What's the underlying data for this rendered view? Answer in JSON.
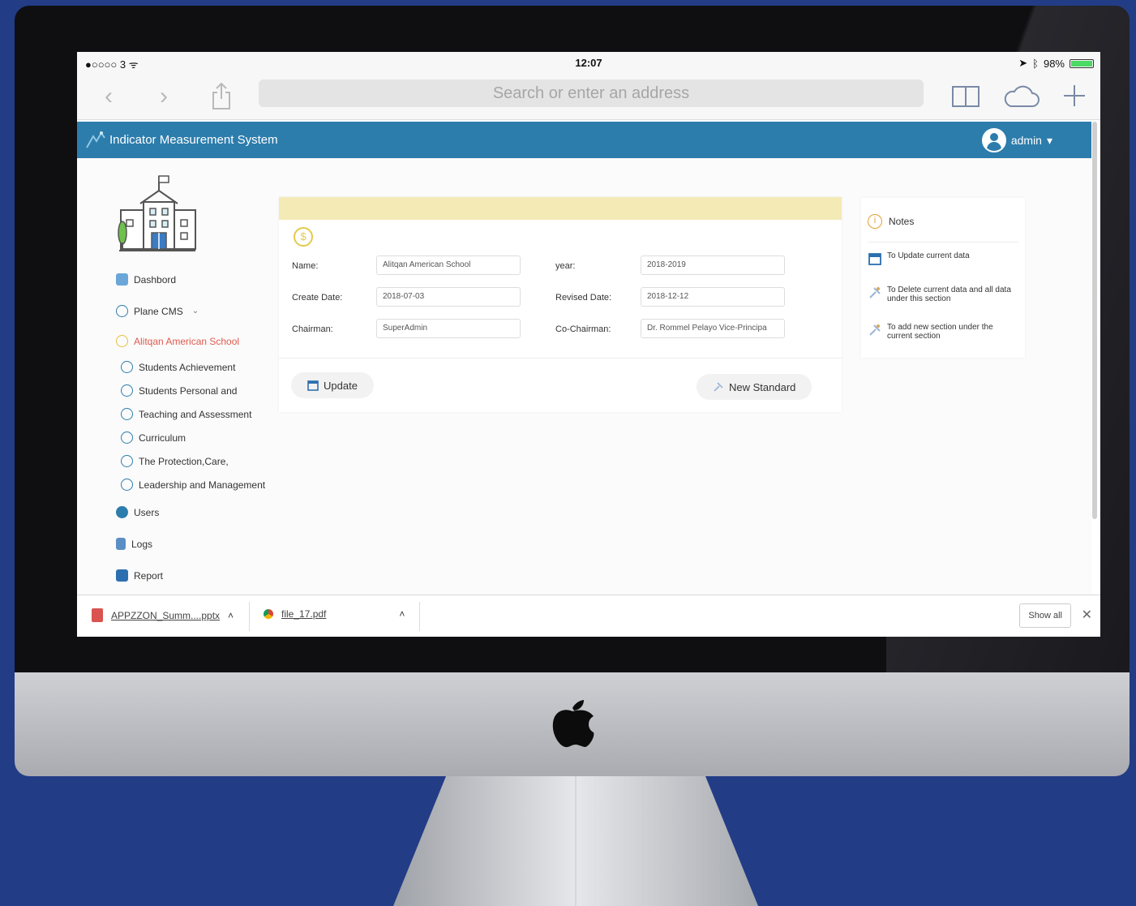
{
  "status_bar": {
    "carrier": "●○○○○ 3 ᯤ",
    "time": "12:07",
    "battery_text": "98%",
    "location_icon": "location-arrow-icon",
    "bluetooth_icon": "bluetooth-icon"
  },
  "browser": {
    "address_placeholder": "Search or enter an address",
    "icons": [
      "back-icon",
      "forward-icon",
      "share-icon",
      "bookmarks-icon",
      "cloud-icon",
      "new-tab-icon"
    ]
  },
  "app": {
    "title": "Indicator Measurement System",
    "user": "admin",
    "header_color": "#2c7dac"
  },
  "sidebar": {
    "items": [
      {
        "label": "Dashbord",
        "icon": "dashboard-icon"
      },
      {
        "label": "Plane CMS",
        "icon": "cms-icon"
      },
      {
        "label": "Alitqan American School",
        "icon": "coin-icon",
        "active": true
      },
      {
        "label": "Students Achievement",
        "icon": "section-icon"
      },
      {
        "label": "Students Personal and",
        "icon": "section-icon"
      },
      {
        "label": "Teaching and Assessment",
        "icon": "section-icon"
      },
      {
        "label": "Curriculum",
        "icon": "section-icon"
      },
      {
        "label": "The Protection,Care,",
        "icon": "section-icon"
      },
      {
        "label": "Leadership and Management",
        "icon": "section-icon"
      },
      {
        "label": "Users",
        "icon": "user-icon"
      },
      {
        "label": "Logs",
        "icon": "logs-icon"
      },
      {
        "label": "Report",
        "icon": "printer-icon"
      }
    ]
  },
  "form": {
    "name_label": "Name:",
    "name_value": "Alitqan American School",
    "year_label": "year:",
    "year_value": "2018-2019",
    "create_date_label": "Create Date:",
    "create_date_value": "2018-07-03",
    "revised_date_label": "Revised Date:",
    "revised_date_value": "2018-12-12",
    "chairman_label": "Chairman:",
    "chairman_value": "SuperAdmin",
    "cochairman_label": "Co-Chairman:",
    "cochairman_value": "Dr. Rommel Pelayo Vice-Principa",
    "update_label": "Update",
    "new_standard_label": "New Standard"
  },
  "notes": {
    "title": "Notes",
    "items": [
      {
        "text": "To Update current data",
        "icon": "calendar-edit-icon"
      },
      {
        "text": "To Delete current data and all data under this section",
        "icon": "delete-icon"
      },
      {
        "text": "To add new section under the current section",
        "icon": "add-section-icon"
      }
    ]
  },
  "downloads": {
    "files": [
      {
        "name": "APPZZON_Summ....pptx",
        "icon": "pptx-icon"
      },
      {
        "name": "file_17.pdf",
        "icon": "pdf-icon"
      }
    ],
    "show_all": "Show all"
  }
}
